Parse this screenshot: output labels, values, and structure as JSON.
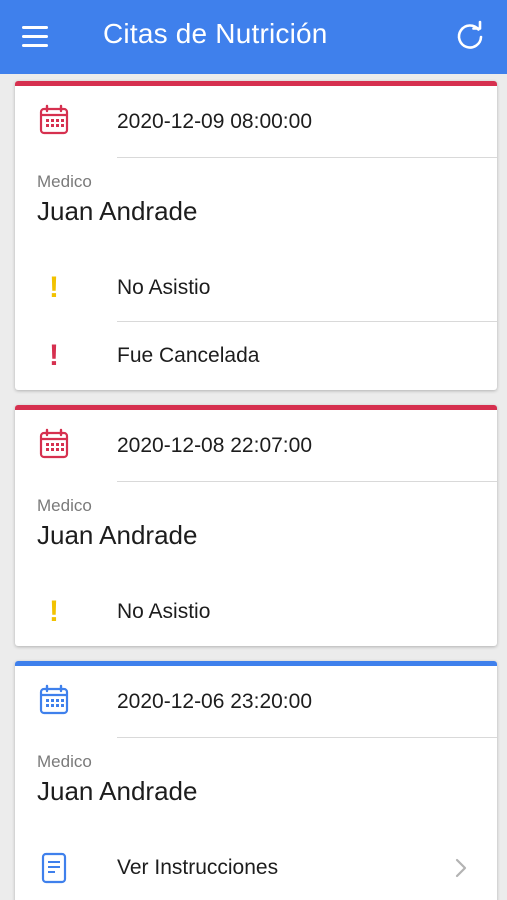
{
  "app": {
    "title": "Citas de Nutrición",
    "menu_icon": "menu-icon",
    "refresh_icon": "refresh-icon",
    "colors": {
      "appbar": "#3f80ec",
      "cancelled": "#d6304f",
      "active": "#3f80ec",
      "warning": "#f2c200"
    }
  },
  "appointments": [
    {
      "status_color": "#d6304f",
      "datetime": "2020-12-09 08:00:00",
      "doctor_label": "Medico",
      "doctor_name": "Juan Andrade",
      "status_lines": [
        {
          "icon": "exclamation-icon",
          "color": "#f2c200",
          "text": "No Asistio"
        },
        {
          "icon": "exclamation-icon",
          "color": "#d6304f",
          "text": "Fue Cancelada"
        }
      ]
    },
    {
      "status_color": "#d6304f",
      "datetime": "2020-12-08 22:07:00",
      "doctor_label": "Medico",
      "doctor_name": "Juan Andrade",
      "status_lines": [
        {
          "icon": "exclamation-icon",
          "color": "#f2c200",
          "text": "No Asistio"
        }
      ]
    },
    {
      "status_color": "#3f80ec",
      "datetime": "2020-12-06 23:20:00",
      "doctor_label": "Medico",
      "doctor_name": "Juan Andrade",
      "action": {
        "icon": "document-icon",
        "text": "Ver Instrucciones",
        "chevron": "chevron-right-icon"
      }
    }
  ]
}
